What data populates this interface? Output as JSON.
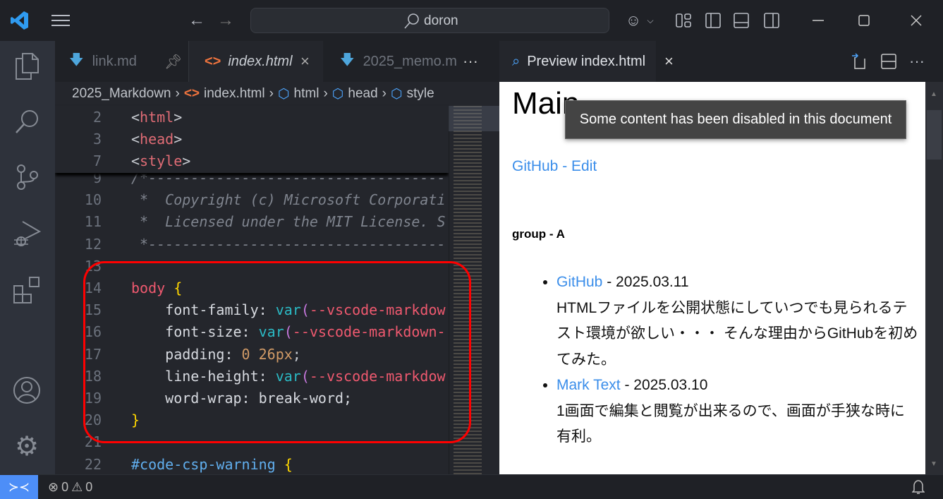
{
  "titlebar": {
    "search_text": "doron"
  },
  "tabs": [
    {
      "label": "link.md"
    },
    {
      "label": "index.html"
    },
    {
      "label": "2025_memo.m"
    }
  ],
  "breadcrumbs": [
    "2025_Markdown",
    "index.html",
    "html",
    "head",
    "style"
  ],
  "sticky_lines": [
    {
      "n": "2",
      "tokens": [
        [
          "<",
          "punc"
        ],
        [
          "html",
          "tag"
        ],
        [
          ">",
          "punc"
        ]
      ]
    },
    {
      "n": "3",
      "tokens": [
        [
          "<",
          "punc"
        ],
        [
          "head",
          "tag"
        ],
        [
          ">",
          "punc"
        ]
      ]
    },
    {
      "n": "7",
      "tokens": [
        [
          "<",
          "punc"
        ],
        [
          "style",
          "tag"
        ],
        [
          ">",
          "punc"
        ]
      ]
    }
  ],
  "code_lines": [
    {
      "n": "9",
      "tokens": [
        [
          "/*-----------------------------------",
          "com"
        ]
      ]
    },
    {
      "n": "10",
      "tokens": [
        [
          " *  Copyright (c) Microsoft Corporati",
          "com"
        ]
      ]
    },
    {
      "n": "11",
      "tokens": [
        [
          " *  Licensed under the MIT License. S",
          "com"
        ]
      ]
    },
    {
      "n": "12",
      "tokens": [
        [
          " *-----------------------------------",
          "com"
        ]
      ]
    },
    {
      "n": "13",
      "tokens": []
    },
    {
      "n": "14",
      "tokens": [
        [
          "body",
          "sel"
        ],
        [
          " ",
          "punc"
        ],
        [
          "{",
          "brace"
        ]
      ]
    },
    {
      "n": "15",
      "tokens": [
        [
          "    font-family: ",
          "prop"
        ],
        [
          "var",
          "fn"
        ],
        [
          "(",
          "paren"
        ],
        [
          "--vscode-markdow",
          "var"
        ]
      ]
    },
    {
      "n": "16",
      "tokens": [
        [
          "    font-size: ",
          "prop"
        ],
        [
          "var",
          "fn"
        ],
        [
          "(",
          "paren"
        ],
        [
          "--vscode-markdown-",
          "var"
        ]
      ]
    },
    {
      "n": "17",
      "tokens": [
        [
          "    padding: ",
          "prop"
        ],
        [
          "0 26px",
          "num"
        ],
        [
          ";",
          "punc"
        ]
      ]
    },
    {
      "n": "18",
      "tokens": [
        [
          "    line-height: ",
          "prop"
        ],
        [
          "var",
          "fn"
        ],
        [
          "(",
          "paren"
        ],
        [
          "--vscode-markdow",
          "var"
        ]
      ]
    },
    {
      "n": "19",
      "tokens": [
        [
          "    word-wrap: break-word;",
          "prop"
        ]
      ]
    },
    {
      "n": "20",
      "tokens": [
        [
          "}",
          "brace"
        ]
      ]
    },
    {
      "n": "21",
      "tokens": []
    },
    {
      "n": "22",
      "tokens": [
        [
          "#code-csp-warning",
          "id"
        ],
        [
          " ",
          "punc"
        ],
        [
          "{",
          "brace"
        ]
      ]
    }
  ],
  "preview_tab": {
    "label": "Preview index.html"
  },
  "preview": {
    "heading": "Main",
    "tooltip": "Some content has been disabled in this document",
    "edit_link": "GitHub - Edit",
    "group_title": "group - A",
    "items": [
      {
        "link": "GitHub",
        "date": " - 2025.03.11",
        "desc": "HTMLファイルを公開状態にしていつでも見られるテスト環境が欲しい・・・ そんな理由からGitHubを初めてみた。"
      },
      {
        "link": "Mark Text",
        "date": " - 2025.03.10",
        "desc": "1画面で編集と閲覧が出来るので、画面が手狭な時に有利。"
      }
    ]
  },
  "status": {
    "errors": "0",
    "warnings": "0"
  },
  "colors": {
    "accent": "#4d8ef7",
    "highlight": "#ff0000"
  }
}
